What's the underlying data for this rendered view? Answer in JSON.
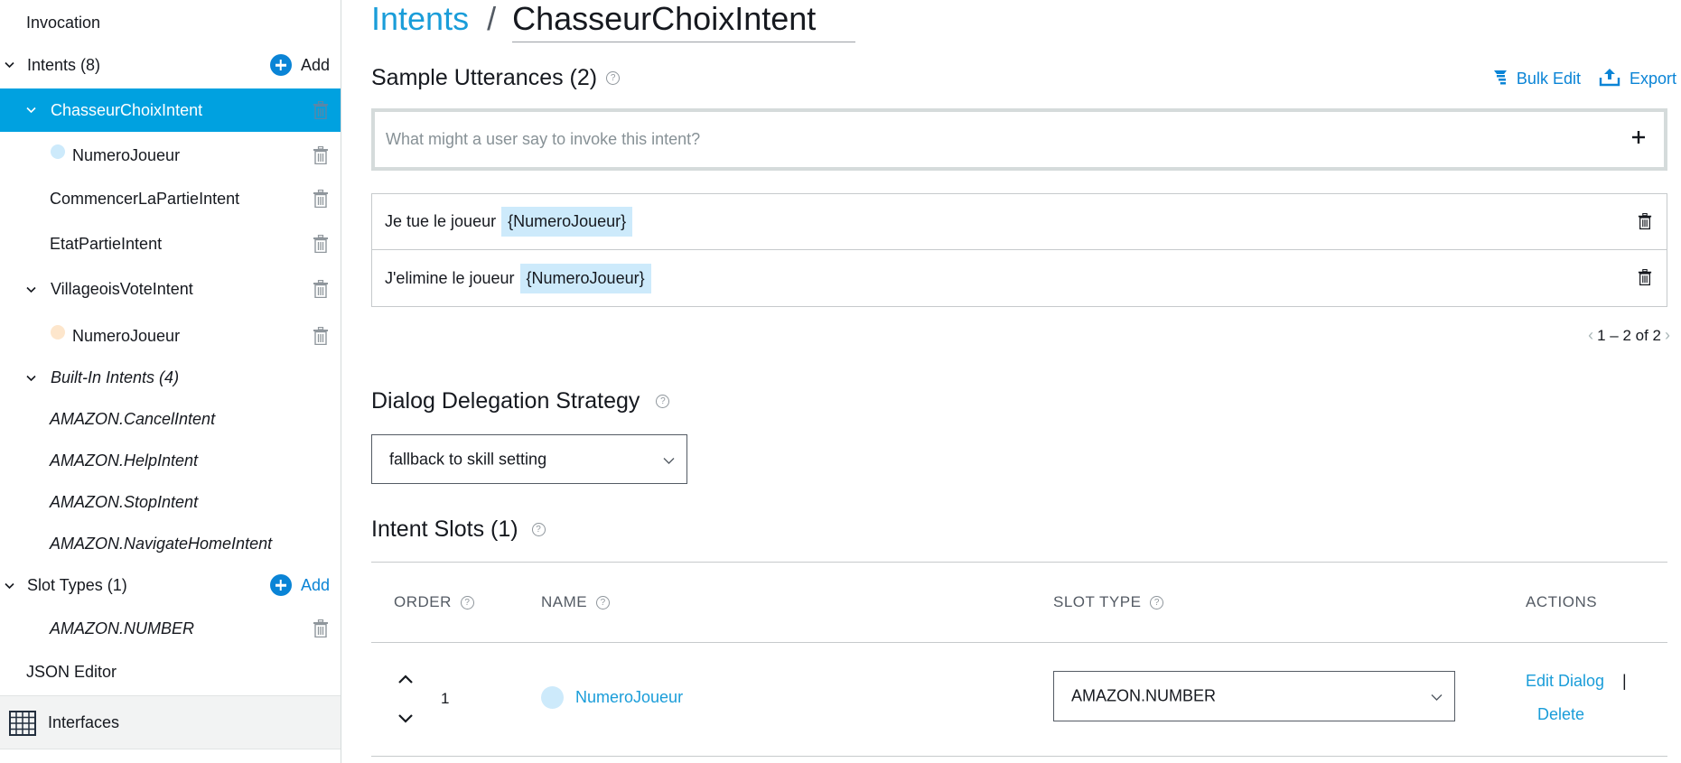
{
  "sidebar": {
    "invocation": "Invocation",
    "intents_header": "Intents (8)",
    "add_label": "Add",
    "intents": [
      {
        "label": "ChasseurChoixIntent"
      },
      {
        "label": "NumeroJoueur"
      },
      {
        "label": "CommencerLaPartieIntent"
      },
      {
        "label": "EtatPartieIntent"
      },
      {
        "label": "VillageoisVoteIntent"
      },
      {
        "label": "NumeroJoueur"
      }
    ],
    "builtin_header": "Built-In Intents (4)",
    "builtin_intents": [
      "AMAZON.CancelIntent",
      "AMAZON.HelpIntent",
      "AMAZON.StopIntent",
      "AMAZON.NavigateHomeIntent"
    ],
    "slot_types_header": "Slot Types (1)",
    "slot_types_add": "Add",
    "slot_types": [
      "AMAZON.NUMBER"
    ],
    "json_editor": "JSON Editor",
    "interfaces": "Interfaces"
  },
  "breadcrumb": {
    "root": "Intents",
    "separator": "/",
    "current": "ChasseurChoixIntent"
  },
  "utterances": {
    "title": "Sample Utterances (2)",
    "bulk_edit": "Bulk Edit",
    "export": "Export",
    "placeholder": "What might a user say to invoke this intent?",
    "items": [
      {
        "text": "Je tue le joueur",
        "slot": "{NumeroJoueur}"
      },
      {
        "text": "J'elimine le joueur",
        "slot": "{NumeroJoueur}"
      }
    ],
    "pager": "1 – 2 of 2"
  },
  "dialog_delegation": {
    "title": "Dialog Delegation Strategy",
    "selected": "fallback to skill setting"
  },
  "intent_slots": {
    "title": "Intent Slots (1)",
    "columns": {
      "order": "ORDER",
      "name": "NAME",
      "slot_type": "SLOT TYPE",
      "actions": "ACTIONS"
    },
    "rows": [
      {
        "order": "1",
        "name": "NumeroJoueur",
        "slot_type": "AMAZON.NUMBER",
        "edit_dialog": "Edit Dialog",
        "separator": "|",
        "delete": "Delete"
      }
    ]
  },
  "colors": {
    "accent": "#00a1e0",
    "link": "#1a9dd9",
    "slot_highlight": "#cdeafb",
    "slot_dot_alt": "#fde6cc"
  },
  "icons": {
    "help": "help-icon",
    "trash": "trash-icon",
    "chevron": "chevron-down-icon",
    "add": "plus-circle-icon"
  }
}
